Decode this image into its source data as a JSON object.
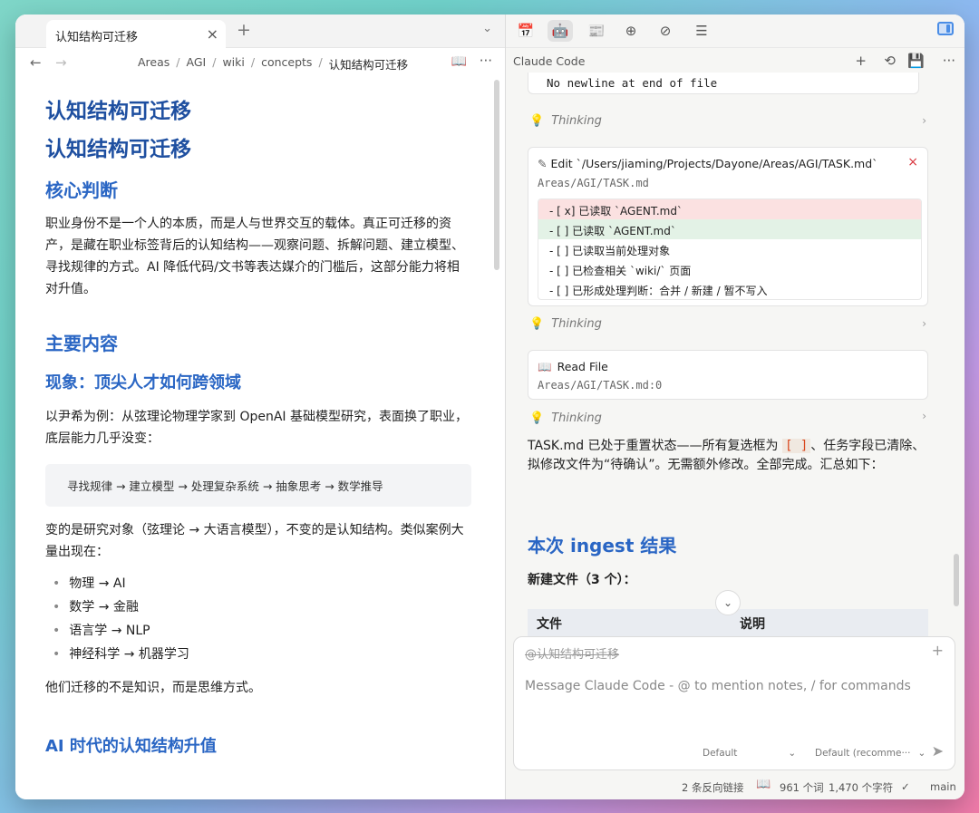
{
  "left": {
    "tab": {
      "title": "认知结构可迁移",
      "close": "×"
    },
    "tab_plus": "+",
    "tab_chevron": "⌄",
    "nav": {
      "back": "←",
      "forward": "→",
      "book": "📖",
      "more": "···"
    },
    "breadcrumb": [
      "Areas",
      "AGI",
      "wiki",
      "concepts",
      "认知结构可迁移"
    ],
    "doc": {
      "h1_a": "认知结构可迁移",
      "h1_b": "认知结构可迁移",
      "h_core": "核心判断",
      "p_core": "职业身份不是一个人的本质，而是人与世界交互的载体。真正可迁移的资产，是藏在职业标签背后的认知结构——观察问题、拆解问题、建立模型、寻找规律的方式。AI 降低代码/文书等表达媒介的门槛后，这部分能力将相对升值。",
      "h_main": "主要内容",
      "h_phen": "现象：顶尖人才如何跨领域",
      "p_phen": "以尹希为例：从弦理论物理学家到 OpenAI 基础模型研究，表面换了职业，底层能力几乎没变：",
      "code": "寻找规律 → 建立模型 → 处理复杂系统 → 抽象思考 → 数学推导",
      "p_change": "变的是研究对象（弦理论 → 大语言模型），不变的是认知结构。类似案例大量出现在：",
      "list": [
        "物理 → AI",
        "数学 → 金融",
        "语言学 → NLP",
        "神经科学 → 机器学习"
      ],
      "p_conclusion": "他们迁移的不是知识，而是思维方式。",
      "h_ai": "AI 时代的认知结构升值"
    }
  },
  "right": {
    "toolbar_icons": [
      "calendar-icon",
      "robot-icon",
      "note-icon",
      "tag-add-icon",
      "tag-remove-icon",
      "list-icon"
    ],
    "toolbar_glyphs": [
      "📅",
      "🤖",
      "📰",
      "⊕",
      "⊘",
      "☰"
    ],
    "header": {
      "title": "Claude Code",
      "plus": "+",
      "history": "⟲",
      "save": "💾",
      "more": "···"
    },
    "no_newline": "No newline at end of file",
    "thinking": "Thinking",
    "thinking_chevron": "›",
    "edit": {
      "title": "Edit `/Users/jiaming/Projects/Dayone/Areas/AGI/TASK.md`",
      "path": "Areas/AGI/TASK.md",
      "close": "×",
      "rows": [
        "- [ x] 已读取 `AGENT.md`",
        "- [ ] 已读取 `AGENT.md`",
        "- [ ] 已读取当前处理对象",
        "- [ ] 已检查相关 `wiki/` 页面",
        "- [ ] 已形成处理判断：合并 / 新建 / 暂不写入"
      ]
    },
    "read": {
      "title": "Read File",
      "path": "Areas/AGI/TASK.md:0"
    },
    "answer_pre": "TASK.md 已处于重置状态——所有复选框为 ",
    "answer_code": "[ ]",
    "answer_post": "、任务字段已清除、拟修改文件为“待确认”。无需额外修改。全部完成。汇总如下：",
    "h_ingest": "本次 ingest 结果",
    "newfiles": "新建文件（3 个）：",
    "table_headers": [
      "文件",
      "说明"
    ],
    "scroll_down": "⌄",
    "composer": {
      "mention": "@认知结构可迁移",
      "plus": "+",
      "placeholder": "Message Claude Code - @ to mention notes, / for commands",
      "model": "Default",
      "mode": "Default (recomme···",
      "send": "➤"
    },
    "status": {
      "backlinks": "2 条反向链接",
      "words": "961 个词",
      "chars": "1,470 个字符",
      "check": "✓",
      "branch": "main"
    }
  }
}
